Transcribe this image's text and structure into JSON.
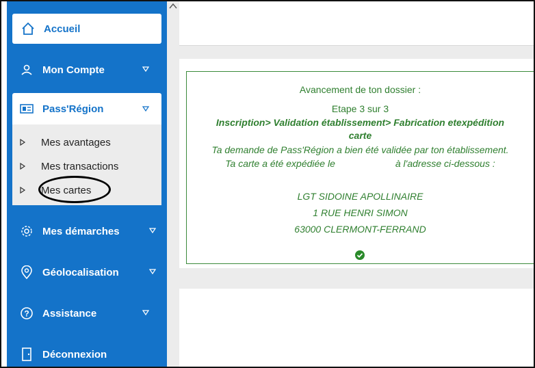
{
  "sidebar": {
    "items": [
      {
        "label": "Accueil",
        "icon": "home-icon"
      },
      {
        "label": "Mon Compte",
        "icon": "user-icon"
      },
      {
        "label": "Pass'Région",
        "icon": "card-icon"
      },
      {
        "label": "Mes démarches",
        "icon": "gear-icon"
      },
      {
        "label": "Géolocalisation",
        "icon": "location-pin-icon"
      },
      {
        "label": "Assistance",
        "icon": "question-icon"
      },
      {
        "label": "Déconnexion",
        "icon": "door-icon"
      }
    ],
    "submenu": [
      "Mes avantages",
      "Mes transactions",
      "Mes cartes"
    ]
  },
  "status_card": {
    "heading": "Avancement de ton dossier :",
    "step": "Etape 3 sur 3",
    "steps_line1": "Inscription> Validation établissement> Fabrication etexpédition",
    "steps_line2": "carte",
    "message_line1": "Ta demande de Pass'Région a bien été validée par ton établissement.",
    "message_line2_a": "Ta carte a été expédiée le",
    "message_line2_b": "à l'adresse ci-dessous :",
    "address": [
      "LGT SIDOINE APOLLINAIRE",
      "1 RUE HENRI SIMON",
      "63000 CLERMONT-FERRAND"
    ]
  },
  "colors": {
    "sidebar": "#1473c9",
    "success_text": "#2f7f2f",
    "check": "#2a8a2a"
  }
}
